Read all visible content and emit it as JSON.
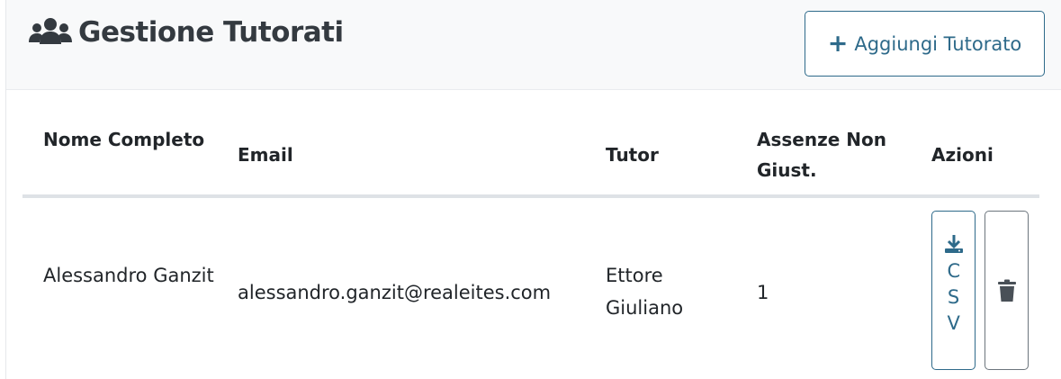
{
  "header": {
    "title": "Gestione Tutorati",
    "title_icon": "users-icon",
    "add_button_label": "Aggiungi Tutorato",
    "add_button_icon": "plus-icon"
  },
  "table": {
    "columns": [
      "Nome Completo",
      "Email",
      "Tutor",
      "Assenze Non Giust.",
      "Azioni"
    ],
    "rows": [
      {
        "name": "Alessandro Ganzit",
        "email": "alessandro.ganzit@realeites.com",
        "tutor": "Ettore Giuliano",
        "absences": "1",
        "csv_label": "CSV",
        "csv_icon": "download-icon",
        "delete_icon": "trash-icon"
      }
    ]
  },
  "colors": {
    "accent": "#2e6a8a",
    "title": "#343a40",
    "header_bg": "#f8f9fa",
    "delete_border": "#6c757d"
  }
}
